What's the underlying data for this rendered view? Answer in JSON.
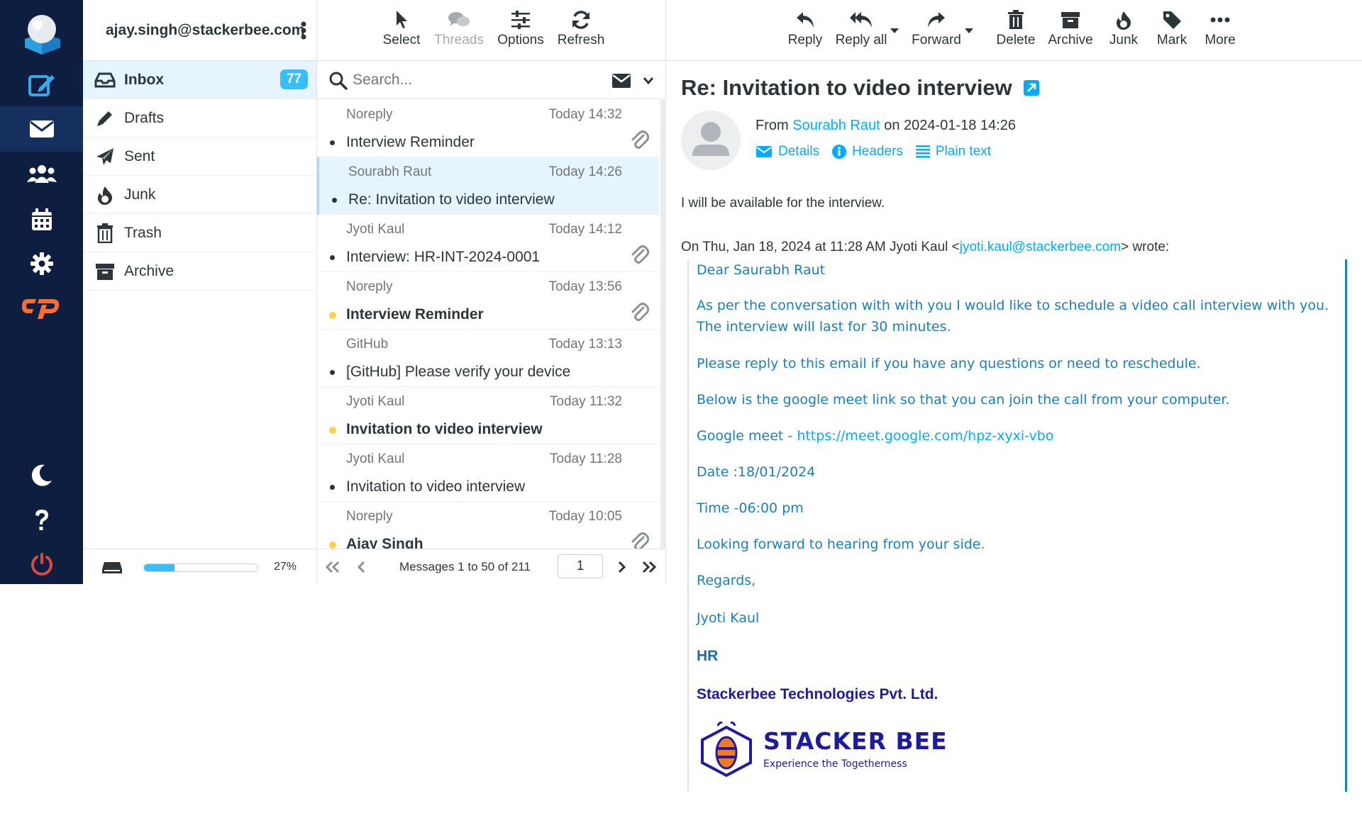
{
  "account": {
    "email": "ajay.singh@stackerbee.com"
  },
  "rail": {
    "items": [
      "logo",
      "compose",
      "mail",
      "contacts",
      "calendar",
      "settings",
      "cpanel",
      "dark-mode",
      "help",
      "logout"
    ]
  },
  "folders": [
    {
      "name": "Inbox",
      "count": "77",
      "icon": "inbox-icon"
    },
    {
      "name": "Drafts",
      "icon": "pencil-icon"
    },
    {
      "name": "Sent",
      "icon": "paper-plane-icon"
    },
    {
      "name": "Junk",
      "icon": "fire-icon"
    },
    {
      "name": "Trash",
      "icon": "trash-icon"
    },
    {
      "name": "Archive",
      "icon": "archive-icon"
    }
  ],
  "quota": {
    "percent_text": "27%",
    "fraction": 0.27
  },
  "list_toolbar": {
    "select": "Select",
    "threads": "Threads",
    "options": "Options",
    "refresh": "Refresh"
  },
  "search": {
    "placeholder": "Search..."
  },
  "messages": [
    {
      "from": "Noreply",
      "date": "Today 14:32",
      "subject": "Interview Reminder",
      "unread": false,
      "attachment": true,
      "selected": false
    },
    {
      "from": "Sourabh Raut",
      "date": "Today 14:26",
      "subject": "Re: Invitation to video interview",
      "unread": false,
      "attachment": false,
      "selected": true
    },
    {
      "from": "Jyoti Kaul",
      "date": "Today 14:12",
      "subject": "Interview: HR-INT-2024-0001",
      "unread": false,
      "attachment": true,
      "selected": false
    },
    {
      "from": "Noreply",
      "date": "Today 13:56",
      "subject": "Interview Reminder",
      "unread": true,
      "attachment": true,
      "selected": false
    },
    {
      "from": "GitHub",
      "date": "Today 13:13",
      "subject": "[GitHub] Please verify your device",
      "unread": false,
      "attachment": false,
      "selected": false
    },
    {
      "from": "Jyoti Kaul",
      "date": "Today 11:32",
      "subject": "Invitation to video interview",
      "unread": true,
      "attachment": false,
      "selected": false
    },
    {
      "from": "Jyoti Kaul",
      "date": "Today 11:28",
      "subject": "Invitation to video interview",
      "unread": false,
      "attachment": false,
      "selected": false
    },
    {
      "from": "Noreply",
      "date": "Today 10:05",
      "subject": "Ajay Singh",
      "unread": true,
      "attachment": true,
      "selected": false
    }
  ],
  "pagination": {
    "label": "Messages 1 to 50 of 211",
    "page": "1"
  },
  "reader_toolbar": {
    "reply": "Reply",
    "reply_all": "Reply all",
    "forward": "Forward",
    "delete": "Delete",
    "archive": "Archive",
    "junk": "Junk",
    "mark": "Mark",
    "more": "More"
  },
  "email": {
    "subject": "Re: Invitation to video interview",
    "from_prefix": "From",
    "from_name": "Sourabh Raut",
    "on_word": "on",
    "sent_date": "2024-01-18 14:26",
    "details": "Details",
    "headers": "Headers",
    "plain_text": "Plain text",
    "body": "I will be available for the interview.",
    "wrote_prefix": "On Thu, Jan 18, 2024 at 11:28 AM Jyoti Kaul <",
    "wrote_email": "jyoti.kaul@stackerbee.com",
    "wrote_suffix": "> wrote:",
    "quoted": {
      "greeting": "Dear Saurabh Raut",
      "p1": "As per the conversation with with you I would like to schedule a video call interview with you. The interview will last for 30 minutes.",
      "p2": "Please reply to this email if you have any questions or need to reschedule.",
      "p3": "Below is the google meet link so that you can join the call from your computer.",
      "meet_label": "Google meet - ",
      "meet_link": "https://meet.google.com/hpz-xyxi-vbo",
      "date": "Date :18/01/2024",
      "time": "Time -06:00 pm",
      "closing": "Looking forward to hearing from your side.",
      "regards": "Regards,",
      "signer": "Jyoti Kaul",
      "dept": "HR",
      "company": "Stackerbee Technologies Pvt. Ltd.",
      "logo_text": "STACKER BEE",
      "logo_tagline": "Experience the Togetherness"
    }
  },
  "colors": {
    "rail_bg": "#0e1e41",
    "accent": "#00acff",
    "badge": "#37beff",
    "cpanel": "#ff6c2c",
    "logout": "#e0473f",
    "quote_text": "#1a7fbd",
    "company": "#1f1ba0"
  }
}
